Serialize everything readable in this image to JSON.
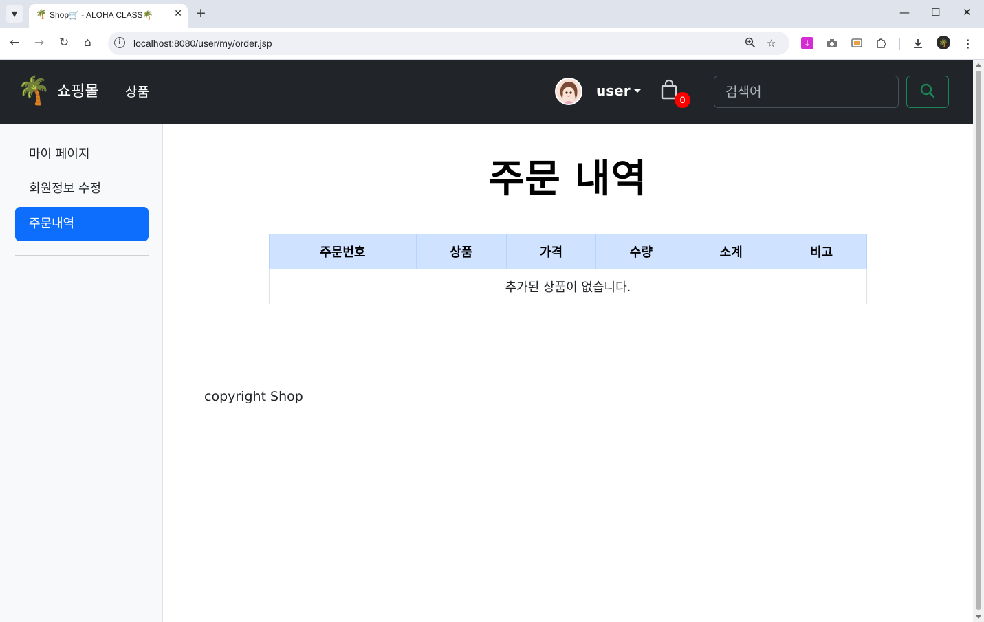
{
  "browser": {
    "tab_title": "Shop🛒 - ALOHA CLASS🌴",
    "tab_favicon": "🌴",
    "url": "localhost:8080/user/my/order.jsp",
    "icons": {
      "tab_menu": "chevron-down-icon",
      "close_tab": "close-icon",
      "new_tab": "plus-icon",
      "back": "arrow-left-icon",
      "forward": "arrow-right-icon",
      "reload": "reload-icon",
      "home": "home-icon",
      "site_info": "info-icon",
      "zoom": "zoom-icon",
      "bookmark": "star-icon",
      "extensions": "puzzle-icon",
      "downloads": "download-icon",
      "menu": "kebab-menu-icon"
    }
  },
  "navbar": {
    "logo": "🌴",
    "brand": "쇼핑몰",
    "links": [
      {
        "label": "상품"
      }
    ],
    "user": {
      "name": "user",
      "avatar_icon": "avatar-girl-icon"
    },
    "cart": {
      "icon": "shopping-bag-icon",
      "count": "0"
    },
    "search": {
      "placeholder": "검색어",
      "value": "",
      "button_icon": "search-icon"
    },
    "colors": {
      "background": "#212529",
      "search_button_border": "#198754",
      "cart_badge": "#ff0000"
    }
  },
  "sidebar": {
    "items": [
      {
        "label": "마이 페이지",
        "active": false
      },
      {
        "label": "회원정보 수정",
        "active": false
      },
      {
        "label": "주문내역",
        "active": true
      }
    ],
    "active_color": "#0d6efd"
  },
  "main": {
    "title": "주문 내역",
    "table": {
      "headers": [
        "주문번호",
        "상품",
        "가격",
        "수량",
        "소계",
        "비고"
      ],
      "rows": [],
      "empty_message": "추가된 상품이 없습니다.",
      "header_color": "#cfe2ff"
    }
  },
  "footer": {
    "text": "copyright Shop"
  }
}
